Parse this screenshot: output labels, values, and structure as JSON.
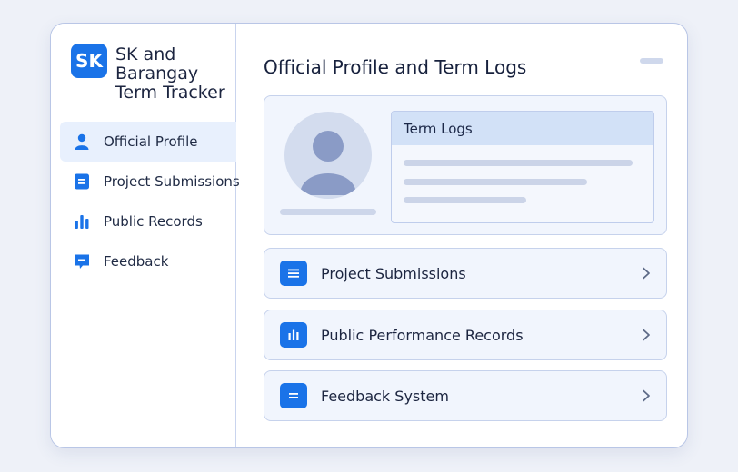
{
  "app": {
    "logo_text": "SK",
    "title": "SK and Barangay Term Tracker"
  },
  "sidebar": {
    "items": [
      {
        "label": "Official Profile",
        "icon": "person-icon",
        "active": true
      },
      {
        "label": "Project Submissions",
        "icon": "document-icon",
        "active": false
      },
      {
        "label": "Public Records",
        "icon": "bar-chart-icon",
        "active": false
      },
      {
        "label": "Feedback",
        "icon": "chat-icon",
        "active": false
      }
    ]
  },
  "main": {
    "title": "Official Profile and Term Logs",
    "profile_card": {
      "avatar_icon": "avatar-placeholder-icon",
      "term_logs_title": "Term Logs"
    },
    "rows": [
      {
        "label": "Project Submissions",
        "icon": "document-icon"
      },
      {
        "label": "Public Performance Records",
        "icon": "bar-chart-icon"
      },
      {
        "label": "Feedback System",
        "icon": "chat-icon"
      }
    ]
  },
  "colors": {
    "accent": "#1a73e8",
    "active_nav_bg": "#e8f0fd",
    "card_bg": "#f1f5fd",
    "border": "#c6d2ec"
  }
}
